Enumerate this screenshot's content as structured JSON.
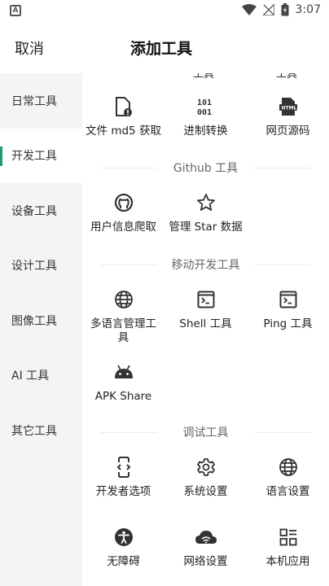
{
  "status_bar": {
    "time": "3:07",
    "notification_letter": "A"
  },
  "header": {
    "cancel_label": "取消",
    "title": "添加工具"
  },
  "sidebar": {
    "items": [
      {
        "label": "日常工具",
        "active": false
      },
      {
        "label": "开发工具",
        "active": true
      },
      {
        "label": "设备工具",
        "active": false
      },
      {
        "label": "设计工具",
        "active": false
      },
      {
        "label": "图像工具",
        "active": false
      },
      {
        "label": "AI 工具",
        "active": false
      },
      {
        "label": "其它工具",
        "active": false
      }
    ]
  },
  "content": {
    "clipped_labels": [
      "工具",
      "工具"
    ],
    "top_tools": [
      {
        "label": "文件 md5 获取",
        "icon": "file-md5-icon"
      },
      {
        "label": "进制转换",
        "icon": "binary-icon"
      },
      {
        "label": "网页源码",
        "icon": "html-file-icon"
      }
    ],
    "sections": [
      {
        "title": "Github 工具",
        "tools": [
          {
            "label": "用户信息爬取",
            "icon": "github-icon"
          },
          {
            "label": "管理 Star 数据",
            "icon": "star-icon"
          }
        ]
      },
      {
        "title": "移动开发工具",
        "tools": [
          {
            "label": "多语言管理工具",
            "icon": "globe-icon"
          },
          {
            "label": "Shell 工具",
            "icon": "terminal-icon"
          },
          {
            "label": "Ping 工具",
            "icon": "terminal-icon"
          },
          {
            "label": "APK Share",
            "icon": "android-icon"
          }
        ]
      },
      {
        "title": "调试工具",
        "tools": [
          {
            "label": "开发者选项",
            "icon": "developer-phone-icon"
          },
          {
            "label": "系统设置",
            "icon": "gear-icon"
          },
          {
            "label": "语言设置",
            "icon": "globe-icon"
          },
          {
            "label": "无障碍",
            "icon": "accessibility-icon"
          },
          {
            "label": "网络设置",
            "icon": "wifi-cloud-icon"
          },
          {
            "label": "本机应用",
            "icon": "apps-grid-icon"
          }
        ]
      }
    ]
  }
}
